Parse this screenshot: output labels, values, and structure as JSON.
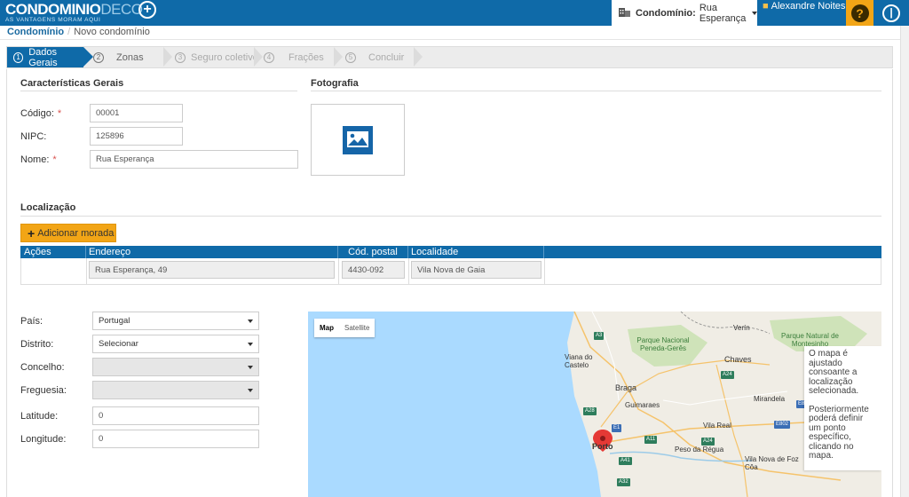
{
  "header": {
    "logo_main_a": "CONDOMINIO",
    "logo_main_b": "DECO",
    "logo_tagline": "AS VANTAGENS MORAM AQUI",
    "condo_label": "Condomínio:",
    "condo_value": "Rua Esperança",
    "user_name": "Alexandre Noites",
    "help_glyph": "?",
    "icons": [
      "building-icon",
      "user-icon",
      "help-icon",
      "power-icon"
    ]
  },
  "breadcrumb": {
    "root": "Condomínio",
    "separator": "/",
    "current": "Novo condomínio"
  },
  "wizard": {
    "steps": [
      {
        "num": "1",
        "label": "Dados Gerais",
        "state": "active"
      },
      {
        "num": "2",
        "label": "Zonas",
        "state": "next"
      },
      {
        "num": "3",
        "label": "Seguro coletivo",
        "state": "disabled"
      },
      {
        "num": "4",
        "label": "Frações",
        "state": "disabled"
      },
      {
        "num": "5",
        "label": "Concluir",
        "state": "disabled"
      }
    ]
  },
  "general": {
    "title": "Características Gerais",
    "codigo_label": "Código:",
    "codigo_value": "00001",
    "nipc_label": "NIPC:",
    "nipc_value": "125896",
    "nome_label": "Nome:",
    "nome_value": "Rua Esperança",
    "required_mark": "*"
  },
  "photo": {
    "title": "Fotografia",
    "icon": "image-icon"
  },
  "location": {
    "title": "Localização",
    "add_button": "Adicionar morada",
    "add_glyph": "+",
    "columns": [
      "Ações",
      "Endereço",
      "Cód. postal",
      "Localidade"
    ],
    "row": {
      "endereco": "Rua Esperança, 49",
      "cod_postal": "4430-092",
      "localidade": "Vila Nova de Gaia"
    }
  },
  "address_form": {
    "pais_label": "País:",
    "pais_value": "Portugal",
    "distrito_label": "Distrito:",
    "distrito_value": "Selecionar",
    "concelho_label": "Concelho:",
    "concelho_value": "",
    "freguesia_label": "Freguesia:",
    "freguesia_value": "",
    "latitude_label": "Latitude:",
    "latitude_value": "0",
    "longitude_label": "Longitude:",
    "longitude_value": "0"
  },
  "map": {
    "tab_map": "Map",
    "tab_satellite": "Satellite",
    "info_p1": "O mapa é ajustado consoante a localização selecionada.",
    "info_p2": "Posteriormente poderá definir um ponto específico, clicando no mapa.",
    "places": {
      "viana": "Viana do Castelo",
      "parque_peneda": "Parque Nacional Peneda-Gerês",
      "parque_montesinho": "Parque Natural de Montesinho",
      "verin": "Verín",
      "chaves": "Chaves",
      "braga": "Braga",
      "guimaraes": "Guimaraes",
      "mirandela": "Mirandela",
      "vila_real": "Vila Real",
      "porto": "Porto",
      "peso_regua": "Peso da Régua",
      "vila_nova_foz_coa": "Vila Nova de Foz Côa"
    },
    "roads": {
      "a3": "A3",
      "a28": "A28",
      "a11": "A11",
      "a24": "A24",
      "a24b": "A24",
      "a41": "A41",
      "a32": "A32",
      "e1": "E1",
      "e82": "E82",
      "e802": "E802"
    },
    "colors": {
      "water": "#aadaff",
      "land": "#f0ede5",
      "park": "#cfe3b9",
      "pin": "#e53935"
    }
  }
}
